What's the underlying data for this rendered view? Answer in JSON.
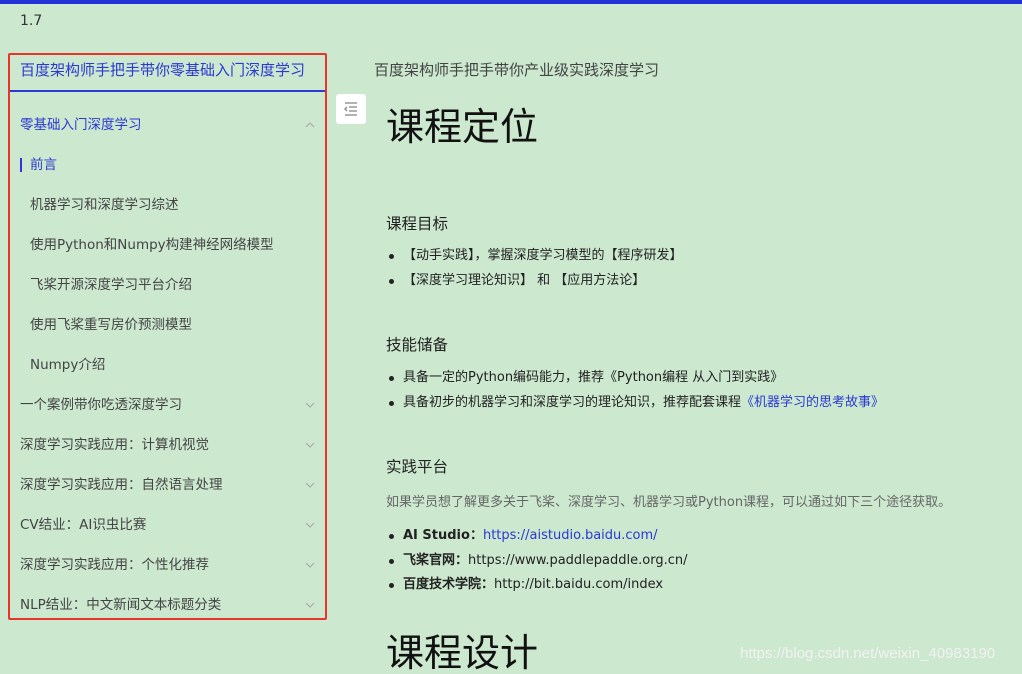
{
  "version": "1.7",
  "tabs": [
    {
      "label": "百度架构师手把手带你零基础入门深度学习",
      "active": true
    },
    {
      "label": "百度架构师手把手带你产业级实践深度学习",
      "active": false
    }
  ],
  "sidebar": {
    "items": [
      {
        "label": "零基础入门深度学习",
        "level": "group",
        "expanded": true
      },
      {
        "label": "前言",
        "level": "child",
        "active": true
      },
      {
        "label": "机器学习和深度学习综述",
        "level": "child"
      },
      {
        "label": "使用Python和Numpy构建神经网络模型",
        "level": "child"
      },
      {
        "label": "飞桨开源深度学习平台介绍",
        "level": "child"
      },
      {
        "label": "使用飞桨重写房价预测模型",
        "level": "child"
      },
      {
        "label": "Numpy介绍",
        "level": "child"
      },
      {
        "label": "一个案例带你吃透深度学习",
        "level": "group",
        "expanded": false
      },
      {
        "label": "深度学习实践应用：计算机视觉",
        "level": "group",
        "expanded": false
      },
      {
        "label": "深度学习实践应用：自然语言处理",
        "level": "group",
        "expanded": false
      },
      {
        "label": "CV结业：AI识虫比赛",
        "level": "group",
        "expanded": false
      },
      {
        "label": "深度学习实践应用：个性化推荐",
        "level": "group",
        "expanded": false
      },
      {
        "label": "NLP结业：中文新闻文本标题分类",
        "level": "group",
        "expanded": false
      }
    ]
  },
  "icons": {
    "toggle": "sidebar-toggle-icon",
    "chevron_up": "chevron-up-icon",
    "chevron_down": "chevron-down-icon"
  },
  "colors": {
    "background": "#cce8cf",
    "accent": "#2b38d3",
    "highlight_border": "#e8342b"
  },
  "content": {
    "title": "课程定位",
    "goals": {
      "heading": "课程目标",
      "items": [
        "【动手实践】，掌握深度学习模型的【程序研发】",
        "【深度学习理论知识】 和 【应用方法论】"
      ]
    },
    "skills": {
      "heading": "技能储备",
      "item1": "具备一定的Python编码能力，推荐《Python编程 从入门到实践》",
      "item2_prefix": "具备初步的机器学习和深度学习的理论知识，推荐配套课程",
      "item2_link": "《机器学习的思考故事》"
    },
    "platform": {
      "heading": "实践平台",
      "intro": "如果学员想了解更多关于飞桨、深度学习、机器学习或Python课程，可以通过如下三个途径获取。",
      "links": [
        {
          "label": "AI Studio：",
          "url": "https://aistudio.baidu.com/",
          "is_link": true
        },
        {
          "label": "飞桨官网：",
          "url": "https://www.paddlepaddle.org.cn/",
          "is_link": false
        },
        {
          "label": "百度技术学院：",
          "url": "http://bit.baidu.com/index",
          "is_link": false
        }
      ]
    },
    "title2": "课程设计"
  },
  "watermark": "https://blog.csdn.net/weixin_40983190"
}
